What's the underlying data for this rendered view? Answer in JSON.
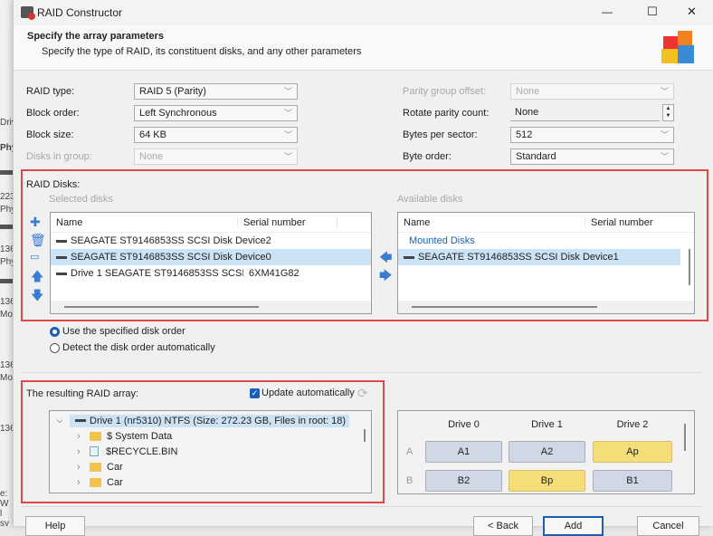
{
  "background": {
    "items": [
      "Driv",
      "Phys",
      "223",
      "Phy",
      "136",
      "Phy",
      "136",
      "Mo",
      "136",
      "Mo",
      "136",
      "e: W",
      "l sy"
    ]
  },
  "window": {
    "title": "RAID Constructor",
    "minimize": "—",
    "maximize": "☐",
    "close": "✕"
  },
  "header": {
    "title": "Specify the array parameters",
    "subtitle": "Specify the type of RAID, its constituent disks, and any other parameters"
  },
  "params": {
    "raid_type": {
      "label": "RAID type:",
      "value": "RAID 5 (Parity)"
    },
    "block_order": {
      "label": "Block order:",
      "value": "Left Synchronous"
    },
    "block_size": {
      "label": "Block size:",
      "value": "64 KB"
    },
    "disks_in_group": {
      "label": "Disks in group:",
      "value": "None"
    },
    "parity_group_offset": {
      "label": "Parity group offset:",
      "value": "None"
    },
    "rotate_parity_count": {
      "label": "Rotate parity count:",
      "value": "None"
    },
    "bytes_per_sector": {
      "label": "Bytes per sector:",
      "value": "512"
    },
    "byte_order": {
      "label": "Byte order:",
      "value": "Standard"
    }
  },
  "raid_disks": {
    "label": "RAID Disks:",
    "selected": {
      "title": "Selected disks",
      "columns": [
        "Name",
        "Serial number"
      ],
      "rows": [
        {
          "name": "SEAGATE ST9146853SS SCSI Disk Device2",
          "serial": ""
        },
        {
          "name": "SEAGATE ST9146853SS SCSI Disk Device0",
          "serial": "",
          "selected": true
        },
        {
          "name": "Drive 1 SEAGATE ST9146853SS SCSI Dis...",
          "serial": "6XM41G82"
        }
      ]
    },
    "available": {
      "title": "Available disks",
      "columns": [
        "Name",
        "Serial number"
      ],
      "group": "Mounted Disks",
      "rows": [
        {
          "name": "SEAGATE ST9146853SS SCSI Disk Device1",
          "selected": true
        }
      ]
    }
  },
  "disk_order": {
    "options": [
      "Use the specified disk order",
      "Detect the disk order automatically"
    ],
    "selected": 0
  },
  "result": {
    "label": "The resulting RAID array:",
    "update_auto": "Update automatically",
    "update_checked": true,
    "root": "Drive 1 (nr5310) NTFS (Size: 272.23 GB, Files in root: 18)",
    "children": [
      "$ System Data",
      "$RECYCLE.BIN",
      "Car",
      "Car"
    ]
  },
  "layout_grid": {
    "drives": [
      "Drive 0",
      "Drive 1",
      "Drive 2"
    ],
    "rows": [
      {
        "label": "A",
        "cells": [
          "A1",
          "A2",
          "Ap"
        ]
      },
      {
        "label": "B",
        "cells": [
          "B2",
          "Bp",
          "B1"
        ]
      }
    ],
    "parity_color": "#f5de78",
    "data_color": "#cfd8e4"
  },
  "buttons": {
    "help": "Help",
    "back": "< Back",
    "add": "Add",
    "cancel": "Cancel"
  },
  "colors": {
    "highlight": "#e04848",
    "selection": "#cce2f5",
    "accent": "#1a5fb4"
  }
}
